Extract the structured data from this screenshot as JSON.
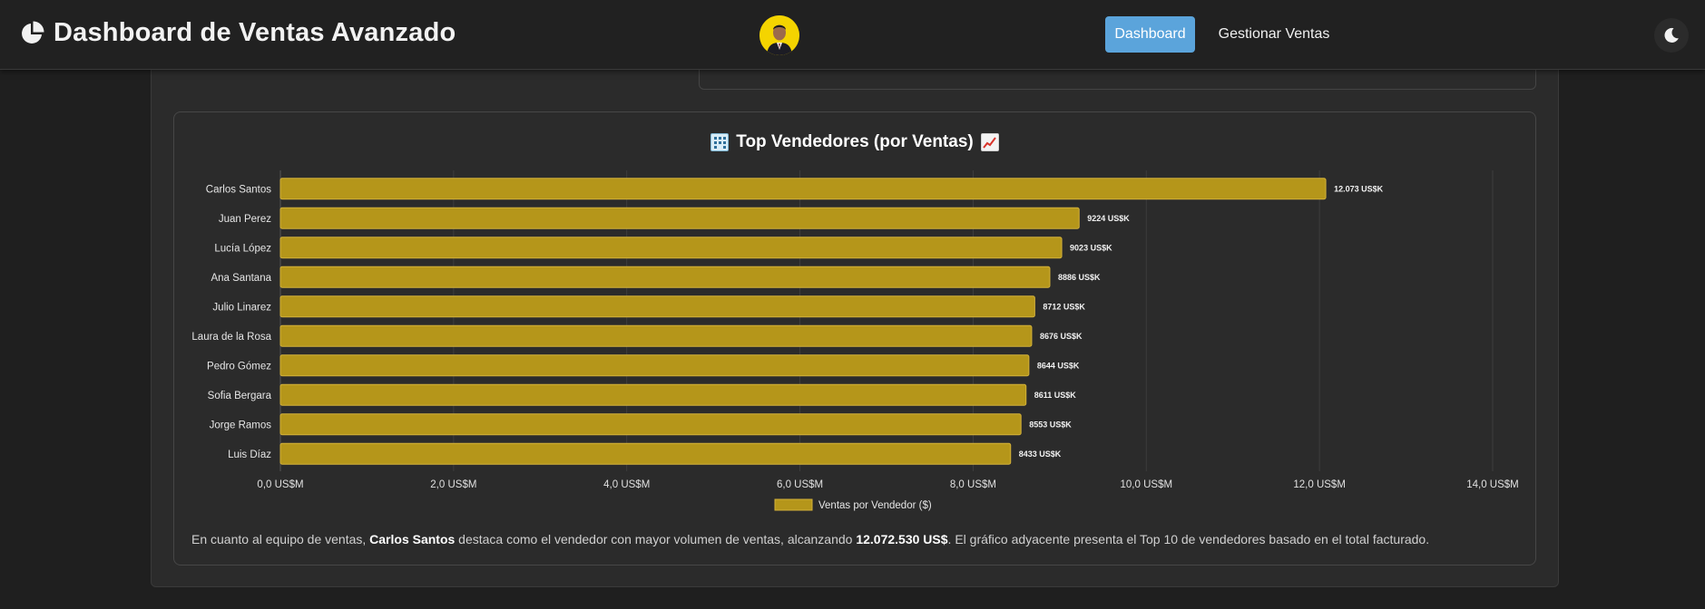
{
  "navbar": {
    "title": "Dashboard de Ventas Avanzado",
    "brand_icon": "pie-chart-icon",
    "nav_items": [
      "Dashboard",
      "Gestionar Ventas"
    ],
    "active_item": "Dashboard",
    "theme_icon": "moon-icon",
    "accent_color": "#5ba4db"
  },
  "chart_card": {
    "title": "Top Vendedores (por Ventas)",
    "title_icons": [
      "office-building-emoji",
      "chart-increasing-emoji"
    ],
    "summary": {
      "prefix": "En cuanto al equipo de ventas, ",
      "top_seller": "Carlos Santos",
      "middle": " destaca como el vendedor con mayor volumen de ventas, alcanzando ",
      "amount": "12.072.530 US$",
      "suffix": ". El gráfico adyacente presenta el Top 10 de vendedores basado en el total facturado."
    }
  },
  "chart_data": {
    "type": "bar",
    "orientation": "horizontal",
    "categories": [
      "Carlos Santos",
      "Juan Perez",
      "Lucía López",
      "Ana Santana",
      "Julio Linarez",
      "Laura de la Rosa",
      "Pedro Gómez",
      "Sofia Bergara",
      "Jorge Ramos",
      "Luis Díaz"
    ],
    "series": [
      {
        "name": "Ventas por Vendedor ($)",
        "values": [
          12072530,
          9224000,
          9023000,
          8886000,
          8712000,
          8676000,
          8644000,
          8611000,
          8553000,
          8433000
        ],
        "data_labels": [
          "12.073 US$K",
          "9224 US$K",
          "9023 US$K",
          "8886 US$K",
          "8712 US$K",
          "8676 US$K",
          "8644 US$K",
          "8611 US$K",
          "8553 US$K",
          "8433 US$K"
        ],
        "color": "#b5961a"
      }
    ],
    "x_ticks": [
      "0,0 US$M",
      "2,0 US$M",
      "4,0 US$M",
      "6,0 US$M",
      "8,0 US$M",
      "10,0 US$M",
      "12,0 US$M",
      "14,0 US$M"
    ],
    "xlim": [
      0,
      14000000
    ],
    "grid": true,
    "legend": "bottom"
  }
}
